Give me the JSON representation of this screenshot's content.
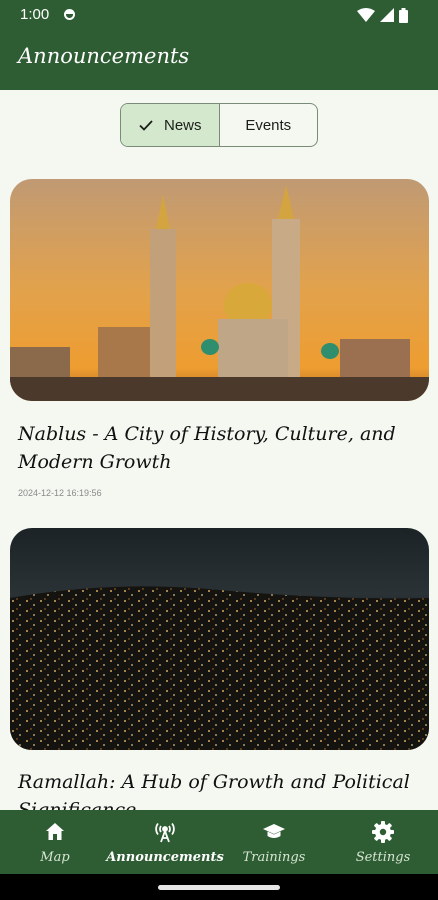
{
  "status_bar": {
    "time": "1:00"
  },
  "app_bar": {
    "title": "Announcements"
  },
  "segments": {
    "news": "News",
    "events": "Events",
    "selected": "News"
  },
  "posts": [
    {
      "title": "Nablus - A City of History, Culture, and Modern Growth",
      "date": "2024-12-12 16:19:56"
    },
    {
      "title": "Ramallah: A Hub of Growth and Political Significance",
      "date": ""
    }
  ],
  "bottom_nav": [
    {
      "label": "Map",
      "icon": "home-icon"
    },
    {
      "label": "Announcements",
      "icon": "broadcast-icon",
      "active": true
    },
    {
      "label": "Trainings",
      "icon": "graduation-cap-icon"
    },
    {
      "label": "Settings",
      "icon": "gear-icon"
    }
  ],
  "colors": {
    "primary": "#2e5d34",
    "background": "#f4f8f1",
    "selected_segment": "#d3e8cd"
  }
}
